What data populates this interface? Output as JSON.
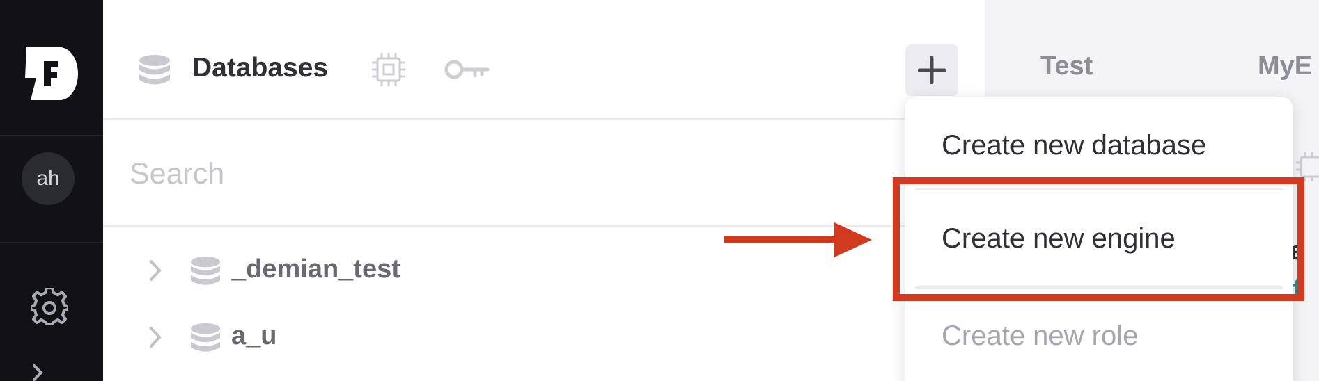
{
  "nav": {
    "avatar_initials": "ah",
    "logo": "firebolt-logo",
    "settings_icon": "gear-icon"
  },
  "panel": {
    "title": "Databases",
    "search": {
      "placeholder": "Search",
      "value": ""
    },
    "databases": [
      {
        "name": "_demian_test"
      },
      {
        "name": "a_u"
      }
    ]
  },
  "menu": {
    "items": [
      {
        "label": "Create new database",
        "enabled": true
      },
      {
        "label": "Create new engine",
        "enabled": true,
        "highlighted": true
      },
      {
        "label": "Create new role",
        "enabled": false
      }
    ]
  },
  "right_panel": {
    "tabs": [
      "Test",
      "MyE"
    ],
    "fragments": [
      "e",
      "f"
    ]
  },
  "colors": {
    "rail": "#111116",
    "annotation": "#d23a20",
    "accent_teal": "#2b8a8a"
  }
}
